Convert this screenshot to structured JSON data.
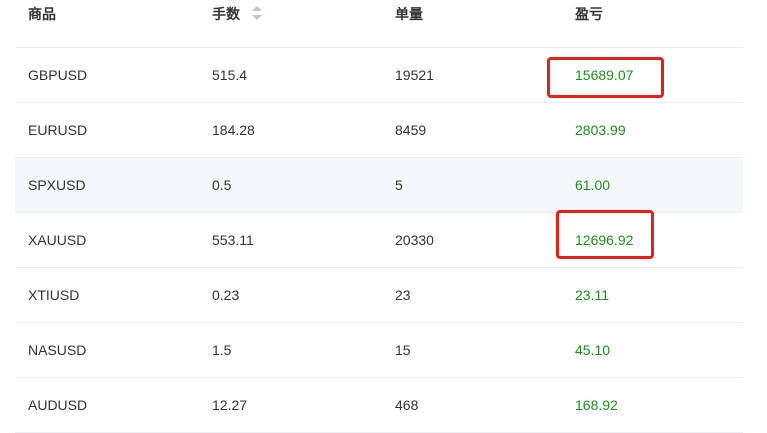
{
  "table": {
    "headers": {
      "product": "商品",
      "lots": "手数",
      "volume": "单量",
      "profit": "盈亏"
    },
    "rows": [
      {
        "product": "GBPUSD",
        "lots": "515.4",
        "volume": "19521",
        "profit": "15689.07"
      },
      {
        "product": "EURUSD",
        "lots": "184.28",
        "volume": "8459",
        "profit": "2803.99"
      },
      {
        "product": "SPXUSD",
        "lots": "0.5",
        "volume": "5",
        "profit": "61.00"
      },
      {
        "product": "XAUUSD",
        "lots": "553.11",
        "volume": "20330",
        "profit": "12696.92"
      },
      {
        "product": "XTIUSD",
        "lots": "0.23",
        "volume": "23",
        "profit": "23.11"
      },
      {
        "product": "NASUSD",
        "lots": "1.5",
        "volume": "15",
        "profit": "45.10"
      },
      {
        "product": "AUDUSD",
        "lots": "12.27",
        "volume": "468",
        "profit": "168.92"
      }
    ]
  },
  "colors": {
    "profit_positive": "#1e8f1e",
    "highlight_annotation": "#e8201c",
    "stripe": "#f5f7fa",
    "divider": "#ebeef5"
  },
  "icons": {
    "sort": "sort-caret-icon"
  }
}
